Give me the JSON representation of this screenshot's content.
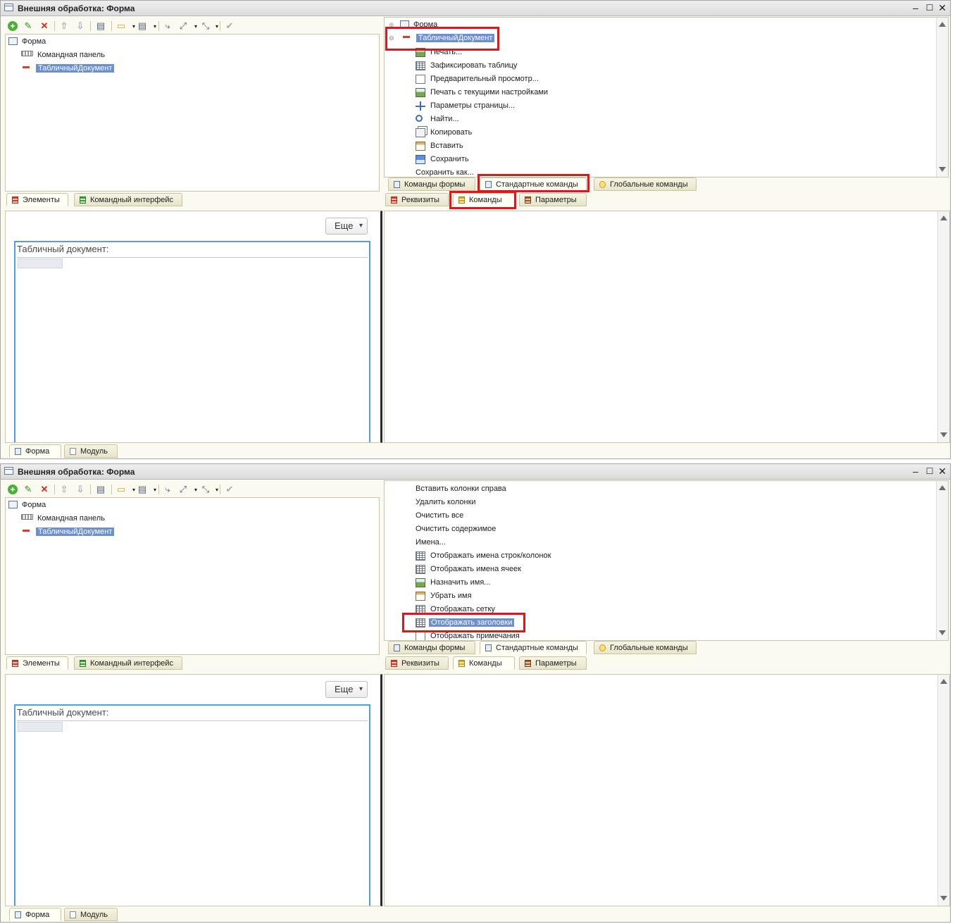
{
  "window_title": "Внешняя обработка: Форма",
  "window_controls": {
    "minimize": "–",
    "maximize": "☐",
    "close": "✕"
  },
  "tree": {
    "form": "Форма",
    "command_bar": "Командная панель",
    "spreadsheet": "ТабличныйДокумент"
  },
  "left_tabs": {
    "elements": "Элементы",
    "command_interface": "Командный интерфейс"
  },
  "command_tabs": {
    "form_commands": "Команды формы",
    "standard_commands": "Стандартные команды",
    "global_commands": "Глобальные команды"
  },
  "right_tabs": {
    "attributes": "Реквизиты",
    "commands": "Команды",
    "parameters": "Параметры"
  },
  "bottom_tabs": {
    "form": "Форма",
    "module": "Модуль"
  },
  "preview": {
    "more_button": "Еще",
    "field_label": "Табличный документ:"
  },
  "top_panel": {
    "tree_root": "Форма",
    "tree_group": "ТабличныйДокумент",
    "commands": [
      {
        "label": "Печать...",
        "icon": "print-icon"
      },
      {
        "label": "Зафиксировать таблицу",
        "icon": "grid-icon"
      },
      {
        "label": "Предварительный просмотр...",
        "icon": "preview-icon"
      },
      {
        "label": "Печать с текущими настройками",
        "icon": "print-current-icon"
      },
      {
        "label": "Параметры страницы...",
        "icon": "page-setup-icon"
      },
      {
        "label": "Найти...",
        "icon": "search-icon"
      },
      {
        "label": "Копировать",
        "icon": "copy-icon"
      },
      {
        "label": "Вставить",
        "icon": "paste-icon"
      },
      {
        "label": "Сохранить",
        "icon": "save-icon"
      },
      {
        "label": "Сохранить как...",
        "icon": ""
      }
    ]
  },
  "bottom_panel": {
    "commands": [
      {
        "label": "Вставить колонки справа",
        "icon": ""
      },
      {
        "label": "Удалить колонки",
        "icon": ""
      },
      {
        "label": "Очистить все",
        "icon": ""
      },
      {
        "label": "Очистить содержимое",
        "icon": ""
      },
      {
        "label": "Имена...",
        "icon": ""
      },
      {
        "label": "Отображать имена строк/колонок",
        "icon": "row-col-names-icon"
      },
      {
        "label": "Отображать имена ячеек",
        "icon": "cell-names-icon"
      },
      {
        "label": "Назначить имя...",
        "icon": "assign-name-icon"
      },
      {
        "label": "Убрать имя",
        "icon": "remove-name-icon"
      },
      {
        "label": "Отображать сетку",
        "icon": "grid-icon"
      },
      {
        "label": "Отображать заголовки",
        "icon": "headers-icon"
      },
      {
        "label": "Отображать примечания",
        "icon": "notes-icon"
      }
    ]
  },
  "colors": {
    "highlight": "#e2161a",
    "selection": "#6b8fd1",
    "field_border": "#4aa3df"
  }
}
